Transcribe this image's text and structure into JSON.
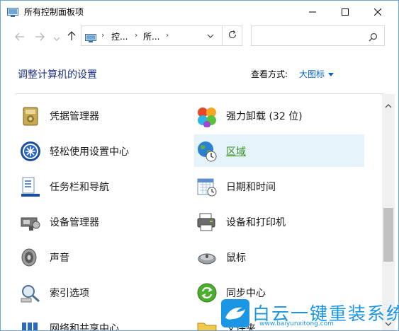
{
  "window": {
    "title": "所有控制面板项",
    "icons": [
      "control-panel-icon",
      "minimize-icon",
      "maximize-icon",
      "close-icon"
    ]
  },
  "navigation": {
    "breadcrumb": [
      "控...",
      "所..."
    ],
    "search_placeholder": ""
  },
  "header": {
    "title": "调整计算机的设置",
    "view_by_label": "查看方式:",
    "view_by_value": "大图标"
  },
  "items_left": [
    {
      "label": "凭据管理器",
      "icon": "credential-manager-icon"
    },
    {
      "label": "轻松使用设置中心",
      "icon": "ease-of-access-icon"
    },
    {
      "label": "任务栏和导航",
      "icon": "taskbar-icon"
    },
    {
      "label": "设备管理器",
      "icon": "device-manager-icon"
    },
    {
      "label": "声音",
      "icon": "speaker-icon"
    },
    {
      "label": "索引选项",
      "icon": "indexing-icon"
    },
    {
      "label": "网络和共享中心",
      "icon": "network-icon"
    }
  ],
  "items_right": [
    {
      "label": "强力卸载 (32 位)",
      "icon": "uninstaller-icon"
    },
    {
      "label": "区域",
      "icon": "region-globe-icon",
      "highlighted": true
    },
    {
      "label": "日期和时间",
      "icon": "date-time-icon"
    },
    {
      "label": "设备和打印机",
      "icon": "printer-icon"
    },
    {
      "label": "鼠标",
      "icon": "mouse-icon"
    },
    {
      "label": "同步中心",
      "icon": "sync-icon"
    },
    {
      "label": "文件夹",
      "icon": "folder-icon"
    }
  ],
  "watermark": {
    "text": "白云一键重装系统",
    "url": "www.baiyunxitong.com"
  },
  "colors": {
    "accent": "#0066cc",
    "heading": "#1e3287",
    "hover_bg": "#e5f3fb",
    "hover_text": "#3a8f21",
    "watermark": "#1b96e4"
  }
}
